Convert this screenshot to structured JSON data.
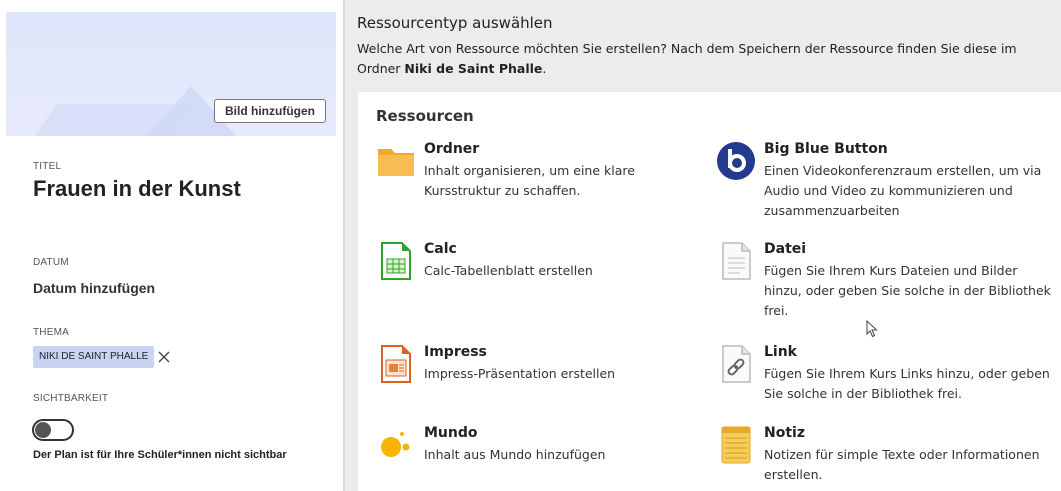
{
  "left": {
    "add_image_label": "Bild hinzufügen",
    "title_label": "TITEL",
    "title_value": "Frauen in der Kunst",
    "date_label": "DATUM",
    "date_value": "Datum hinzufügen",
    "theme_label": "THEMA",
    "theme_chip": "NIKI DE SAINT PHALLE",
    "visibility_label": "SICHTBARKEIT",
    "visibility_on": false,
    "visibility_text": "Der Plan ist für Ihre Schüler*innen nicht sichtbar"
  },
  "right": {
    "title": "Ressourcentyp auswählen",
    "desc_text": "Welche Art von Ressource möchten Sie erstellen? Nach dem Speichern der Ressource finden Sie diese im Ordner ",
    "desc_bold": "Niki de Saint Phalle",
    "desc_end": ".",
    "card_heading": "Ressourcen",
    "resources": [
      {
        "name": "Ordner",
        "desc": "Inhalt organisieren, um eine klare Kursstruktur zu schaffen.",
        "icon": "folder-icon",
        "color": "#f5b443"
      },
      {
        "name": "Big Blue Button",
        "desc": "Einen Videokonferenzraum erstellen, um via Audio und Video zu kommunizieren und zusammenzuarbeiten",
        "icon": "bigbluebutton-icon",
        "color": "#233b8c"
      },
      {
        "name": "Calc",
        "desc": "Calc-Tabellenblatt erstellen",
        "icon": "calc-icon",
        "color": "#2eaa2e"
      },
      {
        "name": "Datei",
        "desc": "Fügen Sie Ihrem Kurs Dateien und Bilder hinzu, oder geben Sie solche in der Bibliothek frei.",
        "icon": "file-icon",
        "color": "#cccccc"
      },
      {
        "name": "Impress",
        "desc": "Impress-Präsentation erstellen",
        "icon": "impress-icon",
        "color": "#d8641f"
      },
      {
        "name": "Link",
        "desc": "Fügen Sie Ihrem Kurs Links hinzu, oder geben Sie solche in der Bibliothek frei.",
        "icon": "link-icon",
        "color": "#bbbbbb"
      },
      {
        "name": "Mundo",
        "desc": "Inhalt aus Mundo hinzufügen",
        "icon": "mundo-icon",
        "color": "#f7b500"
      },
      {
        "name": "Notiz",
        "desc": "Notizen für simple Texte oder Informationen erstellen.",
        "icon": "note-icon",
        "color": "#f4c54c"
      }
    ]
  }
}
